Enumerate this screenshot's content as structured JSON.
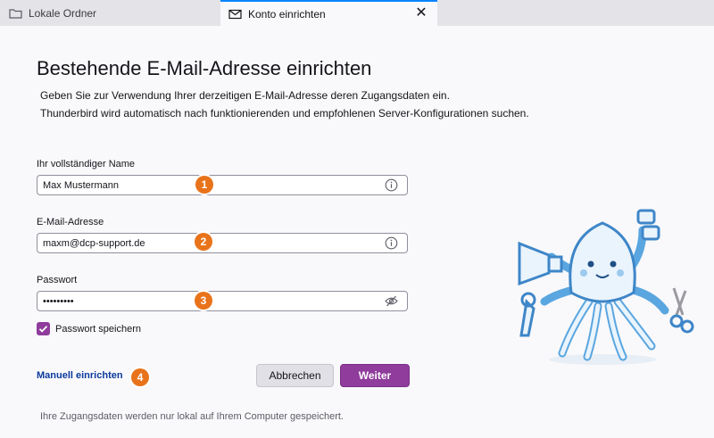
{
  "tabs": [
    {
      "label": "Lokale Ordner",
      "icon": "folder-icon",
      "active": false
    },
    {
      "label": "Konto einrichten",
      "icon": "envelope-icon",
      "active": true
    }
  ],
  "page": {
    "title": "Bestehende E-Mail-Adresse einrichten",
    "description_line1": "Geben Sie zur Verwendung Ihrer derzeitigen E-Mail-Adresse deren Zugangsdaten ein.",
    "description_line2": "Thunderbird wird automatisch nach funktionierenden und empfohlenen Server-Konfigurationen suchen."
  },
  "form": {
    "name": {
      "label": "Ihr vollständiger Name",
      "value": "Max Mustermann",
      "icon": "info-icon"
    },
    "email": {
      "label": "E-Mail-Adresse",
      "value": "maxm@dcp-support.de",
      "icon": "info-icon"
    },
    "password": {
      "label": "Passwort",
      "value": "•••••••••",
      "icon": "eye-slash-icon"
    },
    "remember_password": {
      "label": "Passwort speichern",
      "checked": true
    }
  },
  "annotations": [
    "1",
    "2",
    "3",
    "4"
  ],
  "actions": {
    "manual_setup": "Manuell einrichten",
    "cancel": "Abbrechen",
    "continue": "Weiter"
  },
  "footer": "Ihre Zugangsdaten werden nur lokal auf Ihrem Computer gespeichert.",
  "colors": {
    "accent": "#8f3c9c",
    "badge": "#e8731a",
    "link": "#0b3a9c",
    "tab_highlight": "#0a84ff",
    "mascot": "#5aa6e0"
  }
}
